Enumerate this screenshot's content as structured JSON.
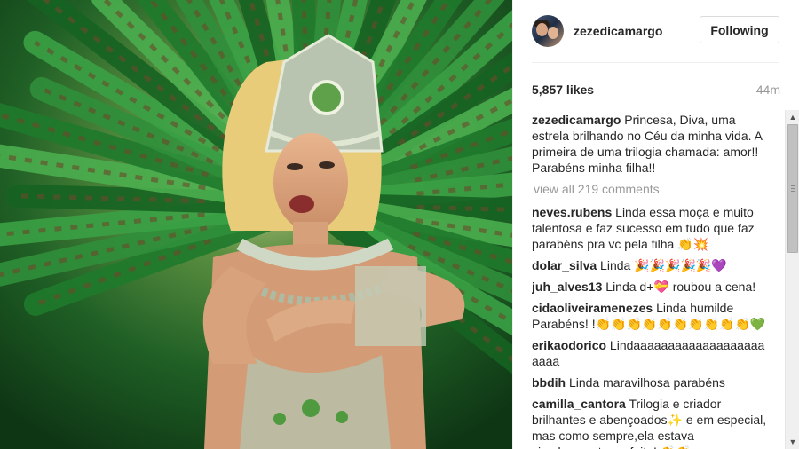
{
  "post": {
    "username": "zezedicamargo",
    "follow_label": "Following",
    "likes": "5,857 likes",
    "time": "44m",
    "caption": {
      "username": "zezedicamargo",
      "text": "Princesa, Diva, uma estrela brilhando no Céu da minha vida. A primeira de uma trilogia chamada: amor!! Parabéns minha filha!!"
    },
    "view_all": "view all 219 comments"
  },
  "comments": [
    {
      "username": "neves.rubens",
      "text": "Linda essa moça e muito talentosa e faz sucesso em tudo que faz parabéns pra vc pela filha 👏💥"
    },
    {
      "username": "dolar_silva",
      "text": "Linda 🎉🎉🎉🎉🎉💜"
    },
    {
      "username": "juh_alves13",
      "text": "Linda d+💝 roubou a cena!"
    },
    {
      "username": "cidaoliveiramenezes",
      "text": "Linda humilde Parabéns! !👏👏👏👏👏👏👏👏👏👏💚"
    },
    {
      "username": "erikaodorico",
      "text": "Lindaaaaaaaaaaaaaaaaaaaaaaa"
    },
    {
      "username": "bbdih",
      "text": "Linda maravilhosa parabéns"
    },
    {
      "username": "camilla_cantora",
      "text": "Trilogia e criador brilhantes e abençoados✨ e em especial, mas como sempre,ela estava simplesmente perfeita! 👏👏"
    }
  ],
  "icons": {
    "scroll_up": "▲",
    "scroll_down": "▼"
  },
  "colors": {
    "text": "#262626",
    "muted": "#999999",
    "border": "#dbdbdb",
    "feather_green": "#2f8f3a"
  }
}
